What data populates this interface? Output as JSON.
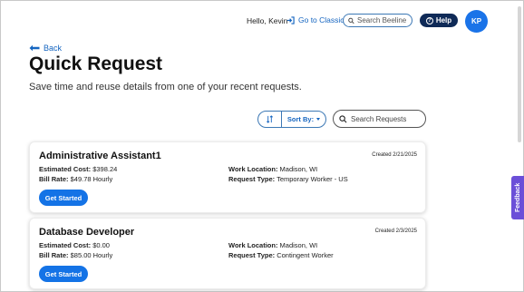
{
  "header": {
    "greeting": "Hello, Kevin",
    "classic_link": "Go to Classic",
    "search_placeholder": "Search Beeline",
    "help_label": "Help",
    "help_icon": "?",
    "avatar_initials": "KP"
  },
  "nav": {
    "back_label": "Back"
  },
  "page": {
    "title": "Quick Request",
    "subtitle": "Save time and reuse details from one of your recent requests."
  },
  "controls": {
    "sort_label": "Sort By:",
    "search_placeholder": "Search Requests"
  },
  "requests": [
    {
      "title": "Administrative Assistant1",
      "created": "Created 2/21/2025",
      "estimated_cost_label": "Estimated Cost:",
      "estimated_cost": "$398.24",
      "bill_rate_label": "Bill Rate:",
      "bill_rate": "$49.78 Hourly",
      "work_location_label": "Work Location:",
      "work_location": "Madison, WI",
      "request_type_label": "Request Type:",
      "request_type": "Temporary Worker - US",
      "button_label": "Get Started"
    },
    {
      "title": "Database Developer",
      "created": "Created 2/3/2025",
      "estimated_cost_label": "Estimated Cost:",
      "estimated_cost": "$0.00",
      "bill_rate_label": "Bill Rate:",
      "bill_rate": "$85.00 Hourly",
      "work_location_label": "Work Location:",
      "work_location": "Madison, WI",
      "request_type_label": "Request Type:",
      "request_type": "Contingent Worker",
      "button_label": "Get Started"
    }
  ],
  "feedback_label": "Feedback",
  "colors": {
    "accent": "#1473e6",
    "link": "#1565c0",
    "help_bg": "#0f2a57",
    "feedback_bg": "#6b4fd8"
  }
}
